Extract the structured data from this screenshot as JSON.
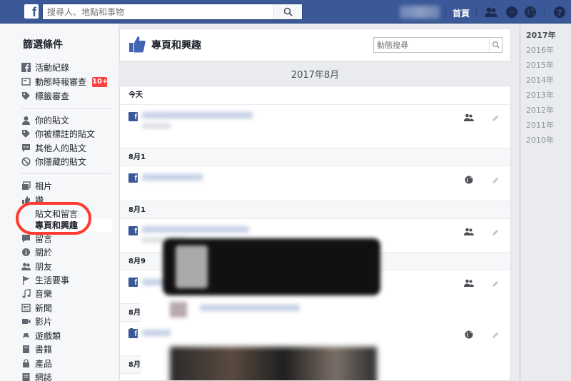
{
  "topbar": {
    "search_placeholder": "搜尋人、地點和事物",
    "home_label": "首頁"
  },
  "leftnav": {
    "title": "篩選條件",
    "badge": "10+",
    "items": [
      {
        "label": "活動紀錄",
        "icon": "fb-square-icon"
      },
      {
        "label": "動態時報審查",
        "icon": "timeline-review-icon"
      },
      {
        "label": "標籤審查",
        "icon": "tag-icon"
      },
      {
        "label": "你的貼文",
        "icon": "person-icon"
      },
      {
        "label": "你被標註的貼文",
        "icon": "tag-icon"
      },
      {
        "label": "其他人的貼文",
        "icon": "comment-icon"
      },
      {
        "label": "你隱藏的貼文",
        "icon": "hidden-icon"
      },
      {
        "label": "相片",
        "icon": "photos-icon"
      },
      {
        "label": "讚",
        "icon": "like-icon"
      },
      {
        "label": "貼文和留言",
        "icon": ""
      },
      {
        "label": "專頁和興趣",
        "icon": ""
      },
      {
        "label": "留言",
        "icon": "comment-icon"
      },
      {
        "label": "關於",
        "icon": "info-icon"
      },
      {
        "label": "朋友",
        "icon": "friends-icon"
      },
      {
        "label": "生活要事",
        "icon": "flag-icon"
      },
      {
        "label": "音樂",
        "icon": "music-icon"
      },
      {
        "label": "新聞",
        "icon": "news-icon"
      },
      {
        "label": "影片",
        "icon": "video-icon"
      },
      {
        "label": "遊戲類",
        "icon": "game-icon"
      },
      {
        "label": "書籍",
        "icon": "book-icon"
      },
      {
        "label": "產品",
        "icon": "product-icon"
      },
      {
        "label": "網誌",
        "icon": "notes-icon"
      }
    ]
  },
  "main": {
    "title": "專頁和興趣",
    "activity_search_placeholder": "動態搜尋",
    "month": "2017年8月",
    "days": [
      "今天",
      "8月1",
      "8月1",
      "8月9",
      "8月6",
      "8月3"
    ]
  },
  "years": [
    "2017年",
    "2016年",
    "2015年",
    "2014年",
    "2013年",
    "2012年",
    "2011年",
    "2010年"
  ],
  "colors": {
    "brand": "#3b5998",
    "badge": "#fa3e3e",
    "highlight_circle": "#ff3b30"
  }
}
